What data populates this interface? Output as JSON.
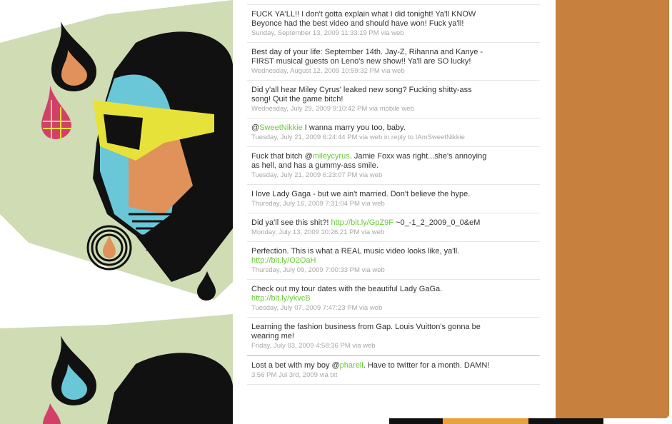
{
  "colors": {
    "side_panel": "#c8803e",
    "link": "#66cc33",
    "text": "#333333",
    "meta": "#a8a8a8",
    "art_green": "#cfdcb4",
    "art_cyan": "#6ac7d8",
    "art_orange": "#e0925a",
    "art_yellow": "#e7e23a"
  },
  "background": {
    "icon_names": [
      "portrait-illustration",
      "drop-icon",
      "plaid-drop-icon",
      "concentric-circle-icon"
    ]
  },
  "tweets": [
    {
      "parts": [
        "FUCK YA'LL!! I don't gotta explain what I did tonight! Ya'll KNOW Beyonce had the best video and should have won! Fuck ya'll!"
      ],
      "meta": "Sunday, September 13, 2009 11:33:19 PM via web"
    },
    {
      "parts": [
        "Best day of your life: September 14th. Jay-Z, Rihanna and Kanye - FIRST musical guests on Leno's new show!! Ya'll are SO lucky!"
      ],
      "meta": "Wednesday, August 12, 2009 10:59:32 PM via web"
    },
    {
      "parts": [
        "Did y'all hear Miley Cyrus' leaked new song? Fucking shitty-ass song! Quit the game bitch!"
      ],
      "meta": "Wednesday, July 29, 2009 9:10:42 PM via mobile web"
    },
    {
      "pre": "@",
      "mention": "SweetNikkie",
      "post": " I wanna marry you too, baby.",
      "meta": "Tuesday, July 21, 2009 6:24:44 PM via web in reply to IAmSweetNikkie"
    },
    {
      "pre": "Fuck that bitch @",
      "mention": "mileycyrus",
      "post": ". Jamie Foxx was right...she's annoying as hell, and has a gummy-ass smile.",
      "meta": "Tuesday, July 21, 2009 6:23:07 PM via web"
    },
    {
      "pre": "I love Lady Gaga - but we ain't married. Don't believe the hype.",
      "meta": "Thursday, July 16, 2009 7:31:04 PM via web"
    },
    {
      "pre": "Did ya'll see this shit?! ",
      "link": "http://bit.ly/GpZ9F",
      "post": " ~0_-1_2_2009_0_0&eM",
      "meta": "Monday, July 13, 2009 10:26:21 PM via web"
    },
    {
      "pre": "Perfection. This is what a REAL music video looks like, ya'll. ",
      "link": "http://bit.ly/O2OaH",
      "post": "",
      "meta": "Thursday, July 09, 2009 7:00:33 PM via web"
    },
    {
      "pre": "Check out my tour dates with the beautiful Lady GaGa. ",
      "link": "http://bit.ly/ykvcB",
      "post": "",
      "meta": "Tuesday, July 07, 2009 7:47:23 PM via web"
    },
    {
      "pre": "Learning the fashion business from Gap. Louis Vuitton's gonna be wearing me!",
      "meta": "Friday, July 03, 2009 4:58:36 PM via web"
    },
    {
      "pre": "Lost a bet with my boy @",
      "mention": "pharell",
      "post": ". Have to twitter for a month. DAMN!",
      "meta": "3:56 PM Jul 3rd, 2009 via txt"
    }
  ]
}
